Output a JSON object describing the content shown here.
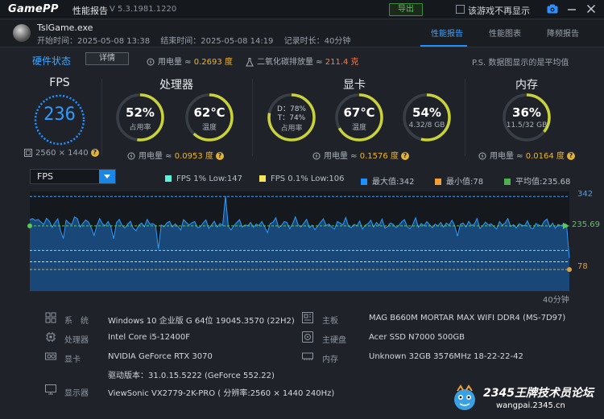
{
  "titlebar": {
    "logo": "GamePP",
    "title": "性能报告",
    "version": "V 5.3.1981.1220",
    "export_label": "导出",
    "no_more_label": "该游戏不再显示"
  },
  "game": {
    "name": "TslGame.exe",
    "start": "开始时间：2025-05-08 13:38",
    "end": "结束时间：2025-05-08 14:19",
    "duration": "记录时长：40分钟"
  },
  "tabs": [
    {
      "label": "性能报告",
      "active": true
    },
    {
      "label": "性能图表",
      "active": false
    },
    {
      "label": "降频报告",
      "active": false
    }
  ],
  "status": {
    "hw_title": "硬件状态",
    "details_label": "详情",
    "power_label": "用电量 ≈ ",
    "power_value": "0.2693 度",
    "co2_label": "二氧化碳排放量 ≈ ",
    "co2_value": "211.4 克",
    "note": "P.S. 数据图显示的是平均值"
  },
  "panels": {
    "fps": {
      "title": "FPS",
      "value": "236",
      "resolution": "2560 × 1440"
    },
    "cpu": {
      "title": "处理器",
      "usage_value": "52%",
      "usage_label": "占用率",
      "usage_pct": 52,
      "temp_value": "62℃",
      "temp_label": "温度",
      "temp_pct": 62,
      "power_label": "用电量 ≈ ",
      "power_value": "0.0953 度"
    },
    "gpu": {
      "title": "显卡",
      "clock_d": "D：78%",
      "clock_t": "T：74%",
      "usage_label": "占用率",
      "usage_pct": 78,
      "temp_value": "67℃",
      "temp_label": "温度",
      "temp_pct": 67,
      "vram_value": "54%",
      "vram_label": "4.32/8 GB",
      "vram_pct": 54,
      "power_label": "用电量 ≈ ",
      "power_value": "0.1576 度"
    },
    "ram": {
      "title": "内存",
      "value": "36%",
      "label": "11.5/32 GB",
      "pct": 36,
      "power_label": "用电量 ≈ ",
      "power_value": "0.0164 度"
    }
  },
  "chart": {
    "selector": "FPS",
    "legend": [
      {
        "label": "FPS 1% Low:147",
        "color": "#5ef0d8"
      },
      {
        "label": "FPS 0.1% Low:106",
        "color": "#f5e35a"
      },
      {
        "label": "最大值:342",
        "color": "#1e8fff"
      },
      {
        "label": "最小值:78",
        "color": "#f0a030"
      },
      {
        "label": "平均值:235.68",
        "color": "#4caf50"
      }
    ],
    "max_label": "342",
    "avg_label": "235.69",
    "min_label": "78",
    "duration_label": "40分钟",
    "colors": {
      "max": "#3da2ff",
      "avg": "#58c858",
      "min": "#e0a040"
    }
  },
  "chart_data": {
    "type": "area",
    "title": "",
    "xlabel": "40分钟",
    "ylabel": "FPS",
    "ylim": [
      0,
      360
    ],
    "max": 342,
    "min": 78,
    "avg": 235.68,
    "low_1pct": 147,
    "low_01pct": 106,
    "series": [
      {
        "name": "FPS",
        "values": [
          258,
          262,
          255,
          259,
          249,
          241,
          263,
          252,
          230,
          247,
          261,
          218,
          190,
          256,
          246,
          240,
          268,
          262,
          231,
          245,
          257,
          249,
          228,
          201,
          237,
          262,
          243,
          236,
          251,
          232,
          189,
          247,
          259,
          237,
          228,
          241,
          252,
          227,
          218,
          238,
          246,
          232,
          259,
          241,
          244,
          237,
          152,
          239,
          232,
          246,
          252,
          231,
          243,
          233,
          221,
          258,
          248,
          239,
          247,
          251,
          229,
          232,
          246,
          257,
          226,
          239,
          252,
          231,
          244,
          238,
          343,
          233,
          221,
          236,
          247,
          258,
          231,
          239,
          236,
          248,
          230,
          242,
          237,
          251,
          233,
          211,
          244,
          249,
          265,
          229,
          236,
          251,
          248,
          225,
          243,
          268,
          239,
          231,
          245,
          259,
          229,
          238,
          222,
          235,
          248,
          261,
          237,
          242,
          231,
          224,
          251,
          246,
          239,
          266,
          234,
          229,
          241,
          236,
          253,
          224,
          238,
          244,
          256,
          231,
          248,
          237,
          260,
          227,
          233,
          246,
          241,
          229,
          237,
          250,
          258,
          233,
          225,
          241,
          265,
          230,
          244,
          236,
          251,
          240,
          229,
          242,
          235,
          248,
          231,
          246,
          238,
          256,
          236,
          198,
          241,
          246,
          231,
          252,
          237,
          242,
          262,
          226,
          236,
          249,
          239,
          243,
          233,
          224,
          251,
          238,
          246,
          262,
          233,
          240,
          228,
          243,
          238,
          236,
          254,
          229,
          225,
          244,
          239,
          235,
          252,
          260,
          231,
          246,
          227,
          241,
          236,
          243,
          241,
          120
        ]
      }
    ]
  },
  "info": {
    "os_label": "系　统",
    "os_value": "Windows 10 企业版 G 64位 19045.3570 (22H2)",
    "cpu_label": "处理器",
    "cpu_value": "Intel Core i5-12400F",
    "gpu_label": "显卡",
    "gpu_value": "NVIDIA GeForce RTX 3070",
    "driver_value": "驱动版本：31.0.15.5222 (GeForce 552.22)",
    "monitor_label": "显示器",
    "monitor_value": "ViewSonic VX2779-2K-PRO ( 分辨率:2560 × 1440 240Hz)",
    "board_label": "主板",
    "board_value": "MAG B660M MORTAR MAX WIFI DDR4 (MS-7D97)",
    "disk_label": "主硬盘",
    "disk_value": "Acer SSD N7000 500GB",
    "mem_label": "内存",
    "mem_value": "Unknown 32GB 3576MHz 18-22-22-42"
  },
  "watermark": {
    "brand": "2345王牌技术员论坛",
    "url": "wangpai.2345.cn"
  }
}
